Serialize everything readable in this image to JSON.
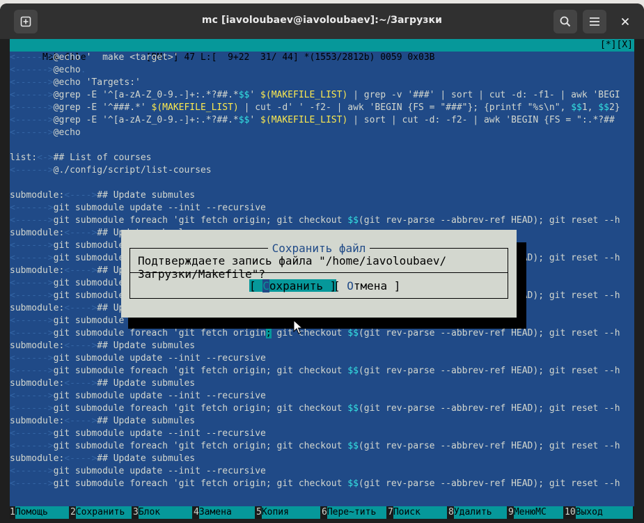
{
  "window": {
    "title": "mc [iavoloubaev@iavoloubaev]:~/Загрузки"
  },
  "background_window": {
    "fragment_1": "s",
    "fragment_2": "ис"
  },
  "statusbar": {
    "left": "Makefile           [BM--] 47 L:[  9+22  31/ 44] *(1553/2812b) 0059 0x03B",
    "right": "[*][X]"
  },
  "dialog": {
    "title": "Сохранить файл",
    "message": "Подтверждаете запись файла \"/home/iavoloubaev/Загрузки/Makefile\"?",
    "save_button": {
      "open": "[ ",
      "hotkey": "С",
      "rest": "охранить ]"
    },
    "cancel_button": {
      "open": "[ ",
      "hotkey": "О",
      "rest": "тмена ]"
    }
  },
  "fkeys": [
    {
      "num": "1",
      "label": "Помощь"
    },
    {
      "num": "2",
      "label": "Сохранить"
    },
    {
      "num": "3",
      "label": "Блок"
    },
    {
      "num": "4",
      "label": "Замена"
    },
    {
      "num": "5",
      "label": "Копия"
    },
    {
      "num": "6",
      "label": "Пере~тить"
    },
    {
      "num": "7",
      "label": "Поиск"
    },
    {
      "num": "8",
      "label": "Удалить"
    },
    {
      "num": "9",
      "label": "МенюMC"
    },
    {
      "num": "10",
      "label": "Выход"
    }
  ],
  "editor_lines": [
    [
      [
        "tab",
        "<------>"
      ],
      [
        "n",
        "@echo '  make <target>'"
      ]
    ],
    [
      [
        "tab",
        "<------>"
      ],
      [
        "n",
        "@echo"
      ],
      [
        "tab",
        "."
      ]
    ],
    [
      [
        "tab",
        "<------>"
      ],
      [
        "n",
        "@echo 'Targets:'"
      ]
    ],
    [
      [
        "tab",
        "<------>"
      ],
      [
        "n",
        "@grep -E '^[a-zA-Z_0-9.-]+:.*?##.*"
      ],
      [
        "cyn",
        "$$"
      ],
      [
        "n",
        "' "
      ],
      [
        "ylw",
        "$(MAKEFILE_LIST)"
      ],
      [
        "n",
        " | grep -v '###' | sort | cut -d: -f1- | awk 'BEGI"
      ]
    ],
    [
      [
        "tab",
        "<------>"
      ],
      [
        "n",
        "@grep -E '^###.*' "
      ],
      [
        "ylw",
        "$(MAKEFILE_LIST)"
      ],
      [
        "n",
        " | cut -d' ' -f2- | awk 'BEGIN {FS = \"###\"}; {printf \"%s\\n\", "
      ],
      [
        "cyn",
        "$$"
      ],
      [
        "n",
        "1, "
      ],
      [
        "cyn",
        "$$"
      ],
      [
        "n",
        "2}"
      ]
    ],
    [
      [
        "tab",
        "<------>"
      ],
      [
        "n",
        "@grep -E '^[a-zA-Z_0-9.-]+:.*?##.*"
      ],
      [
        "cyn",
        "$$"
      ],
      [
        "n",
        "' "
      ],
      [
        "ylw",
        "$(MAKEFILE_LIST)"
      ],
      [
        "n",
        " | sort | cut -d: -f2- | awk 'BEGIN {FS = \":.*?##"
      ]
    ],
    [
      [
        "tab",
        "<------>"
      ],
      [
        "n",
        "@echo"
      ]
    ],
    [],
    [
      [
        "n",
        "list:"
      ],
      [
        "tab",
        "<->"
      ],
      [
        "n",
        "## List of courses"
      ]
    ],
    [
      [
        "tab",
        "<------>"
      ],
      [
        "n",
        "@./config/script/list-courses"
      ]
    ],
    [],
    [
      [
        "n",
        "submodule:"
      ],
      [
        "tab",
        "<---->"
      ],
      [
        "n",
        "## Update submules"
      ]
    ],
    [
      [
        "tab",
        "<------>"
      ],
      [
        "n",
        "git submodule update --init --recursive"
      ]
    ],
    [
      [
        "tab",
        "<------>"
      ],
      [
        "n",
        "git submodule foreach 'git fetch origin; git checkout "
      ],
      [
        "cyn",
        "$$"
      ],
      [
        "n",
        "(git rev-parse --abbrev-ref HEAD); git reset --h"
      ]
    ],
    [
      [
        "n",
        "submodule:"
      ],
      [
        "tab",
        "<---->"
      ],
      [
        "n",
        "## Update submules"
      ]
    ],
    [
      [
        "tab",
        "<------>"
      ],
      [
        "n",
        "git submodule update --init --recursive"
      ]
    ],
    [
      [
        "tab",
        "<------>"
      ],
      [
        "n",
        "git submodule foreach 'git fetch origin; git checkout "
      ],
      [
        "cyn",
        "$$"
      ],
      [
        "n",
        "(git rev-parse --abbrev-ref HEAD); git reset --h"
      ]
    ],
    [
      [
        "n",
        "submodule:"
      ],
      [
        "tab",
        "<---->"
      ],
      [
        "n",
        "## Update submules"
      ]
    ],
    [
      [
        "tab",
        "<------>"
      ],
      [
        "n",
        "git submodule update --init --recursive"
      ]
    ],
    [
      [
        "tab",
        "<------>"
      ],
      [
        "n",
        "git submodule foreach 'git fetch origin; git checkout "
      ],
      [
        "cyn",
        "$$"
      ],
      [
        "n",
        "(git rev-parse --abbrev-ref HEAD); git reset --h"
      ]
    ],
    [
      [
        "n",
        "submodule:"
      ],
      [
        "tab",
        "<---->"
      ],
      [
        "n",
        "## Update submules"
      ]
    ],
    [
      [
        "tab",
        "<------>"
      ],
      [
        "n",
        "git submodule "
      ],
      [
        "hl",
        "update --init --recursive"
      ]
    ],
    [
      [
        "tab",
        "<------>"
      ],
      [
        "n",
        "git submodule foreach 'git fetch origin"
      ],
      [
        "cur",
        ";"
      ],
      [
        "n",
        " git checkout "
      ],
      [
        "cyn",
        "$$"
      ],
      [
        "n",
        "(git rev-parse --abbrev-ref HEAD); git reset --h"
      ]
    ],
    [
      [
        "n",
        "submodule:"
      ],
      [
        "tab",
        "<---->"
      ],
      [
        "n",
        "## Update submules"
      ]
    ],
    [
      [
        "tab",
        "<------>"
      ],
      [
        "n",
        "git submodule update --init --recursive"
      ]
    ],
    [
      [
        "tab",
        "<------>"
      ],
      [
        "n",
        "git submodule foreach 'git fetch origin; git checkout "
      ],
      [
        "cyn",
        "$$"
      ],
      [
        "n",
        "(git rev-parse --abbrev-ref HEAD); git reset --h"
      ]
    ],
    [
      [
        "n",
        "submodule:"
      ],
      [
        "tab",
        "<---->"
      ],
      [
        "n",
        "## Update submules"
      ]
    ],
    [
      [
        "tab",
        "<------>"
      ],
      [
        "n",
        "git submodule update --init --recursive"
      ]
    ],
    [
      [
        "tab",
        "<------>"
      ],
      [
        "n",
        "git submodule foreach 'git fetch origin; git checkout "
      ],
      [
        "cyn",
        "$$"
      ],
      [
        "n",
        "(git rev-parse --abbrev-ref HEAD); git reset --h"
      ]
    ],
    [
      [
        "n",
        "submodule:"
      ],
      [
        "tab",
        "<---->"
      ],
      [
        "n",
        "## Update submules"
      ]
    ],
    [
      [
        "tab",
        "<------>"
      ],
      [
        "n",
        "git submodule update --init --recursive"
      ]
    ],
    [
      [
        "tab",
        "<------>"
      ],
      [
        "n",
        "git submodule foreach 'git fetch origin; git checkout "
      ],
      [
        "cyn",
        "$$"
      ],
      [
        "n",
        "(git rev-parse --abbrev-ref HEAD); git reset --h"
      ]
    ],
    [
      [
        "n",
        "submodule:"
      ],
      [
        "tab",
        "<---->"
      ],
      [
        "n",
        "## Update submules"
      ]
    ],
    [
      [
        "tab",
        "<------>"
      ],
      [
        "n",
        "git submodule update --init --recursive"
      ]
    ],
    [
      [
        "tab",
        "<------>"
      ],
      [
        "n",
        "git submodule foreach 'git fetch origin; git checkout "
      ],
      [
        "cyn",
        "$$"
      ],
      [
        "n",
        "(git rev-parse --abbrev-ref HEAD); git reset --h"
      ]
    ]
  ]
}
